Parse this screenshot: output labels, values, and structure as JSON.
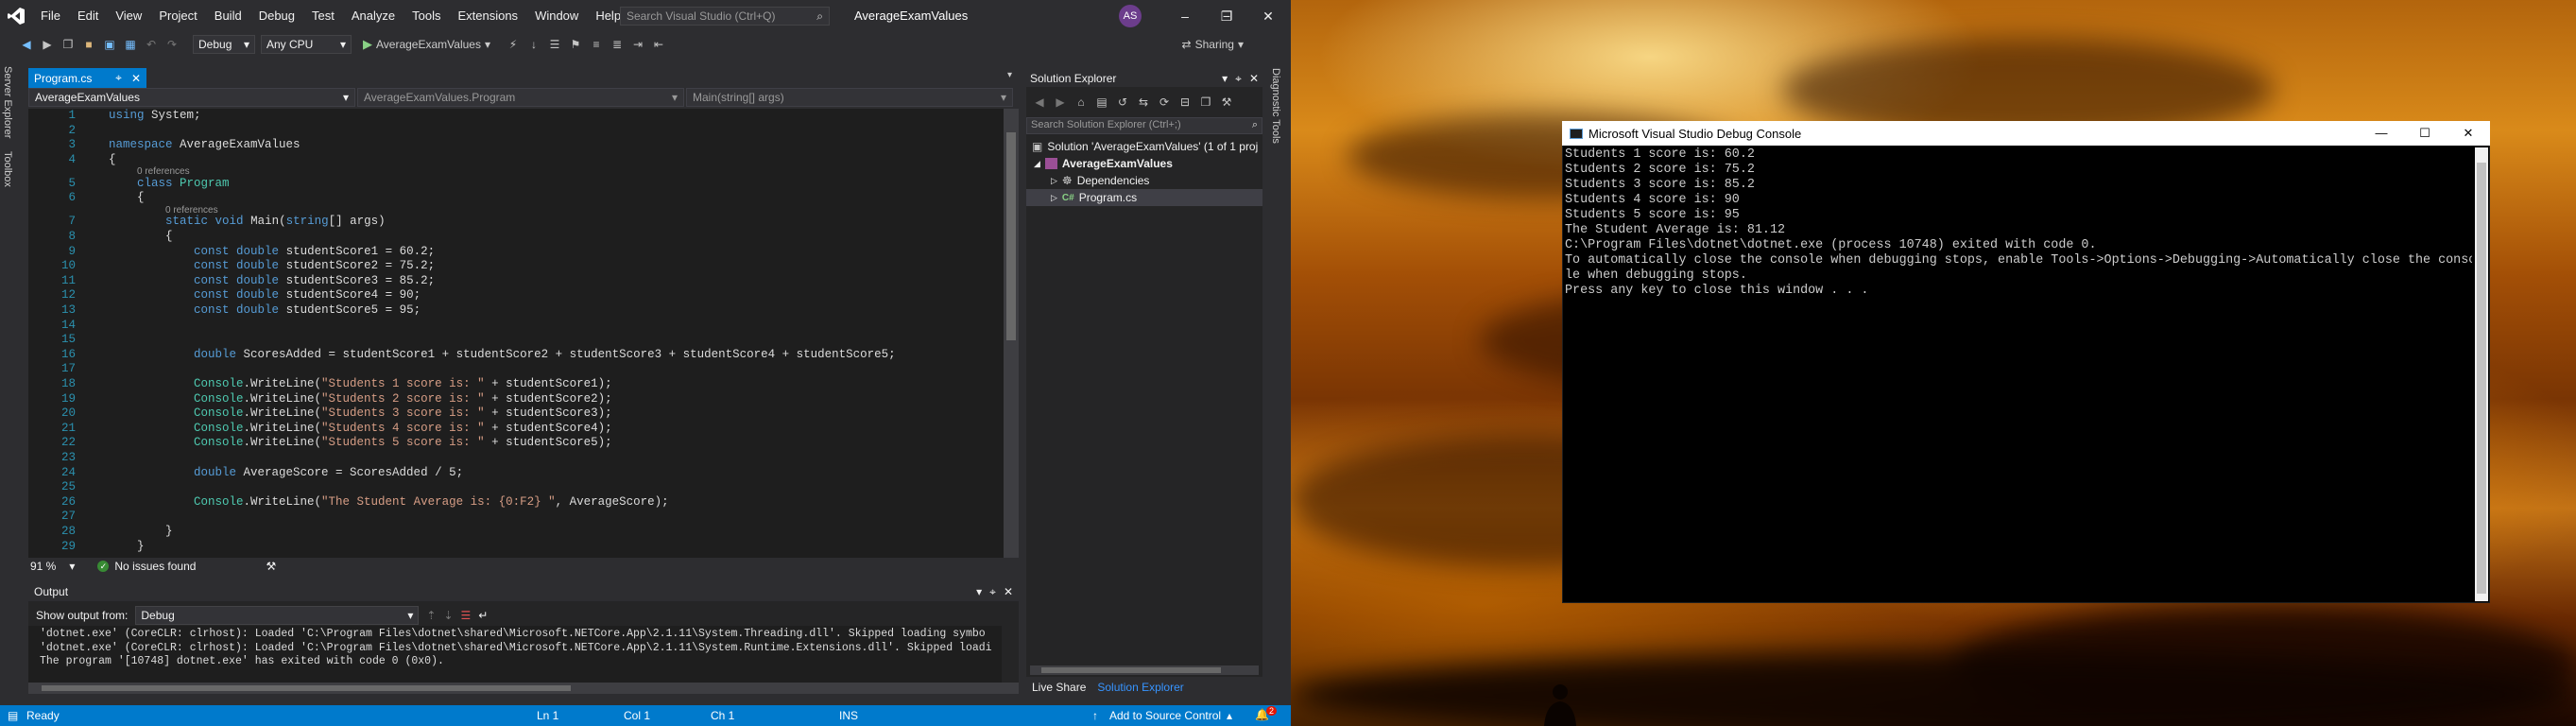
{
  "vs": {
    "menu": [
      "File",
      "Edit",
      "View",
      "Project",
      "Build",
      "Debug",
      "Test",
      "Analyze",
      "Tools",
      "Extensions",
      "Window",
      "Help"
    ],
    "search_placeholder": "Search Visual Studio (Ctrl+Q)",
    "solution_name": "AverageExamValues",
    "avatar": "AS",
    "toolbar": {
      "config": "Debug",
      "platform": "Any CPU",
      "run_target": "AverageExamValues",
      "sharing": "Sharing"
    },
    "side_tabs": {
      "server_explorer": "Server Explorer",
      "toolbox": "Toolbox",
      "diagnostic_tools": "Diagnostic Tools"
    },
    "doc_tab": "Program.cs",
    "nav": {
      "project": "AverageExamValues",
      "class": "AverageExamValues.Program",
      "member": "Main(string[] args)"
    },
    "code": [
      {
        "n": "1",
        "t": "using System;"
      },
      {
        "n": "2",
        "t": ""
      },
      {
        "n": "3",
        "t": "namespace AverageExamValues"
      },
      {
        "n": "4",
        "t": "{"
      },
      {
        "n": "",
        "t": "0 references",
        "ref": true,
        "indent": 1
      },
      {
        "n": "5",
        "t": "    class Program"
      },
      {
        "n": "6",
        "t": "    {"
      },
      {
        "n": "",
        "t": "0 references",
        "ref": true,
        "indent": 2
      },
      {
        "n": "7",
        "t": "        static void Main(string[] args)"
      },
      {
        "n": "8",
        "t": "        {"
      },
      {
        "n": "9",
        "t": "            const double studentScore1 = 60.2;"
      },
      {
        "n": "10",
        "t": "            const double studentScore2 = 75.2;"
      },
      {
        "n": "11",
        "t": "            const double studentScore3 = 85.2;"
      },
      {
        "n": "12",
        "t": "            const double studentScore4 = 90;"
      },
      {
        "n": "13",
        "t": "            const double studentScore5 = 95;"
      },
      {
        "n": "14",
        "t": ""
      },
      {
        "n": "15",
        "t": ""
      },
      {
        "n": "16",
        "t": "            double ScoresAdded = studentScore1 + studentScore2 + studentScore3 + studentScore4 + studentScore5;"
      },
      {
        "n": "17",
        "t": ""
      },
      {
        "n": "18",
        "t": "            Console.WriteLine(\"Students 1 score is: \" + studentScore1);"
      },
      {
        "n": "19",
        "t": "            Console.WriteLine(\"Students 2 score is: \" + studentScore2);"
      },
      {
        "n": "20",
        "t": "            Console.WriteLine(\"Students 3 score is: \" + studentScore3);"
      },
      {
        "n": "21",
        "t": "            Console.WriteLine(\"Students 4 score is: \" + studentScore4);"
      },
      {
        "n": "22",
        "t": "            Console.WriteLine(\"Students 5 score is: \" + studentScore5);"
      },
      {
        "n": "23",
        "t": ""
      },
      {
        "n": "24",
        "t": "            double AverageScore = ScoresAdded / 5;"
      },
      {
        "n": "25",
        "t": ""
      },
      {
        "n": "26",
        "t": "            Console.WriteLine(\"The Student Average is: {0:F2} \", AverageScore);"
      },
      {
        "n": "27",
        "t": ""
      },
      {
        "n": "28",
        "t": "        }"
      },
      {
        "n": "29",
        "t": "    }"
      }
    ],
    "editor_status": {
      "zoom": "91 %",
      "issues": "No issues found"
    },
    "output": {
      "title": "Output",
      "show_from_label": "Show output from:",
      "source": "Debug",
      "lines": [
        "'dotnet.exe' (CoreCLR: clrhost): Loaded 'C:\\Program Files\\dotnet\\shared\\Microsoft.NETCore.App\\2.1.11\\System.Threading.dll'. Skipped loading symbo",
        "'dotnet.exe' (CoreCLR: clrhost): Loaded 'C:\\Program Files\\dotnet\\shared\\Microsoft.NETCore.App\\2.1.11\\System.Runtime.Extensions.dll'. Skipped loadi",
        "The program '[10748] dotnet.exe' has exited with code 0 (0x0)."
      ]
    },
    "solution_explorer": {
      "title": "Solution Explorer",
      "search_placeholder": "Search Solution Explorer (Ctrl+;)",
      "solution": "Solution 'AverageExamValues' (1 of 1 proj",
      "project": "AverageExamValues",
      "dependencies": "Dependencies",
      "file": "Program.cs",
      "bottom_tabs": [
        "Live Share",
        "Solution Explorer"
      ]
    },
    "statusbar": {
      "ready": "Ready",
      "ln": "Ln 1",
      "col": "Col 1",
      "ch": "Ch 1",
      "ins": "INS",
      "source_control": "Add to Source Control",
      "notifications": "2"
    }
  },
  "console": {
    "title": "Microsoft Visual Studio Debug Console",
    "lines": [
      "Students 1 score is: 60.2",
      "Students 2 score is: 75.2",
      "Students 3 score is: 85.2",
      "Students 4 score is: 90",
      "Students 5 score is: 95",
      "The Student Average is: 81.12",
      "",
      "C:\\Program Files\\dotnet\\dotnet.exe (process 10748) exited with code 0.",
      "To automatically close the console when debugging stops, enable Tools->Options->Debugging->Automatically close the conso",
      "le when debugging stops.",
      "Press any key to close this window . . ."
    ]
  },
  "colors": {
    "accent": "#007acc",
    "editor_bg": "#1e1e1e",
    "chrome_bg": "#2d2d30"
  }
}
